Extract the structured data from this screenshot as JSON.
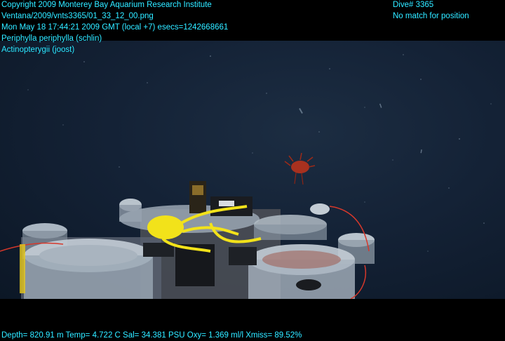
{
  "header_left": {
    "copyright": "Copyright 2009 Monterey Bay Aquarium Research Institute",
    "file_path": "Ventana/2009/vnts3365/01_33_12_00.png",
    "timestamp": "Mon May 18 17:44:21 2009 GMT (local +7)  esecs=1242668661",
    "annotation_1": "Periphylla periphylla (schlin)",
    "annotation_2": "Actinopterygii (joost)"
  },
  "header_right": {
    "dive": "Dive# 3365",
    "position": "No match for position"
  },
  "footer": {
    "telemetry": "Depth= 820.91 m  Temp= 4.722 C  Sal= 34.381 PSU  Oxy= 1.369 ml/l  Xmiss= 89.52%"
  },
  "colors": {
    "overlay_text": "#2ff0ff",
    "water": "#142236",
    "jelly": "#b8321c",
    "rope": "#f2e21a"
  }
}
